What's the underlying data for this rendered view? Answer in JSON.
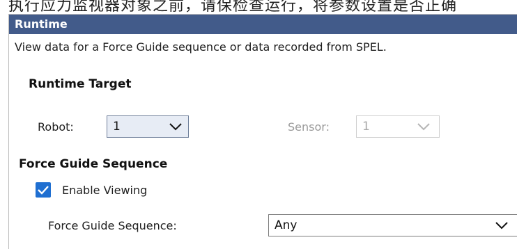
{
  "top_text": "执行应力监视器对象之前，请保检查运行，将参数设置是否正确",
  "panel": {
    "title": "Runtime",
    "description": "View data for a Force Guide sequence or data recorded from SPEL."
  },
  "runtime_target": {
    "title": "Runtime Target",
    "robot_label": "Robot:",
    "robot_value": "1",
    "sensor_label": "Sensor:",
    "sensor_value": "1",
    "sensor_enabled": false
  },
  "force_guide_sequence": {
    "title": "Force Guide Sequence",
    "enable_viewing_label": "Enable Viewing",
    "enable_viewing_checked": true,
    "sequence_label": "Force Guide Sequence:",
    "sequence_value": "Any"
  },
  "colors": {
    "header_bg": "#425b8a",
    "checkbox_accent": "#1f6fd1",
    "disabled_text": "#9a9a9a"
  },
  "icons": {
    "dropdown": "chevron-down-icon",
    "check": "checkmark-icon"
  }
}
